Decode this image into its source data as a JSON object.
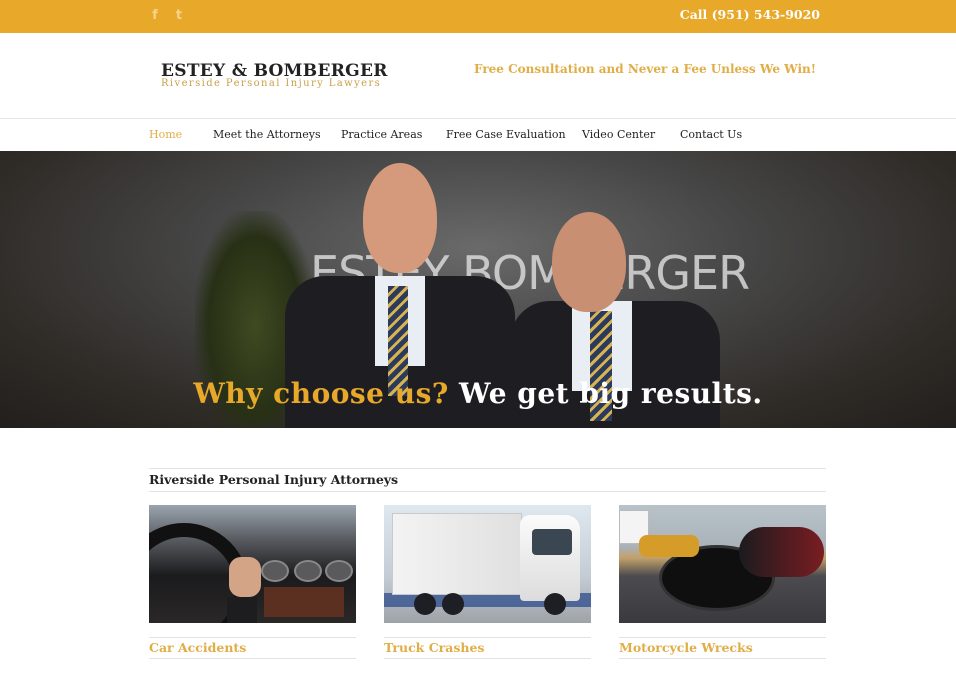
{
  "topbar": {
    "social": [
      {
        "icon": "facebook-icon",
        "glyph": "f"
      },
      {
        "icon": "twitter-icon",
        "glyph": "t"
      }
    ],
    "phone": "Call (951) 543-9020"
  },
  "header": {
    "logo_title": "ESTEY & BOMBERGER",
    "logo_subtitle": "Riverside Personal Injury Lawyers",
    "tagline": "Free Consultation and Never a Fee Unless We Win!"
  },
  "nav": {
    "items": [
      {
        "label": "Home",
        "active": true
      },
      {
        "label": "Meet the Attorneys"
      },
      {
        "label": "Practice Areas"
      },
      {
        "label": "Free Case Evaluation"
      },
      {
        "label": "Video Center"
      },
      {
        "label": "Contact Us"
      }
    ]
  },
  "hero": {
    "wall_text": "ESTEY BOMBERGER",
    "caption_part1": "Why choose us?",
    "caption_part2": "We get big results."
  },
  "section": {
    "title": "Riverside Personal Injury Attorneys",
    "cards": [
      {
        "label": "Car Accidents"
      },
      {
        "label": "Truck Crashes"
      },
      {
        "label": "Motorcycle Wrecks"
      }
    ]
  },
  "colors": {
    "brand_gold": "#e8a92a",
    "link_gold": "#e0ad46",
    "text_dark": "#222222"
  }
}
